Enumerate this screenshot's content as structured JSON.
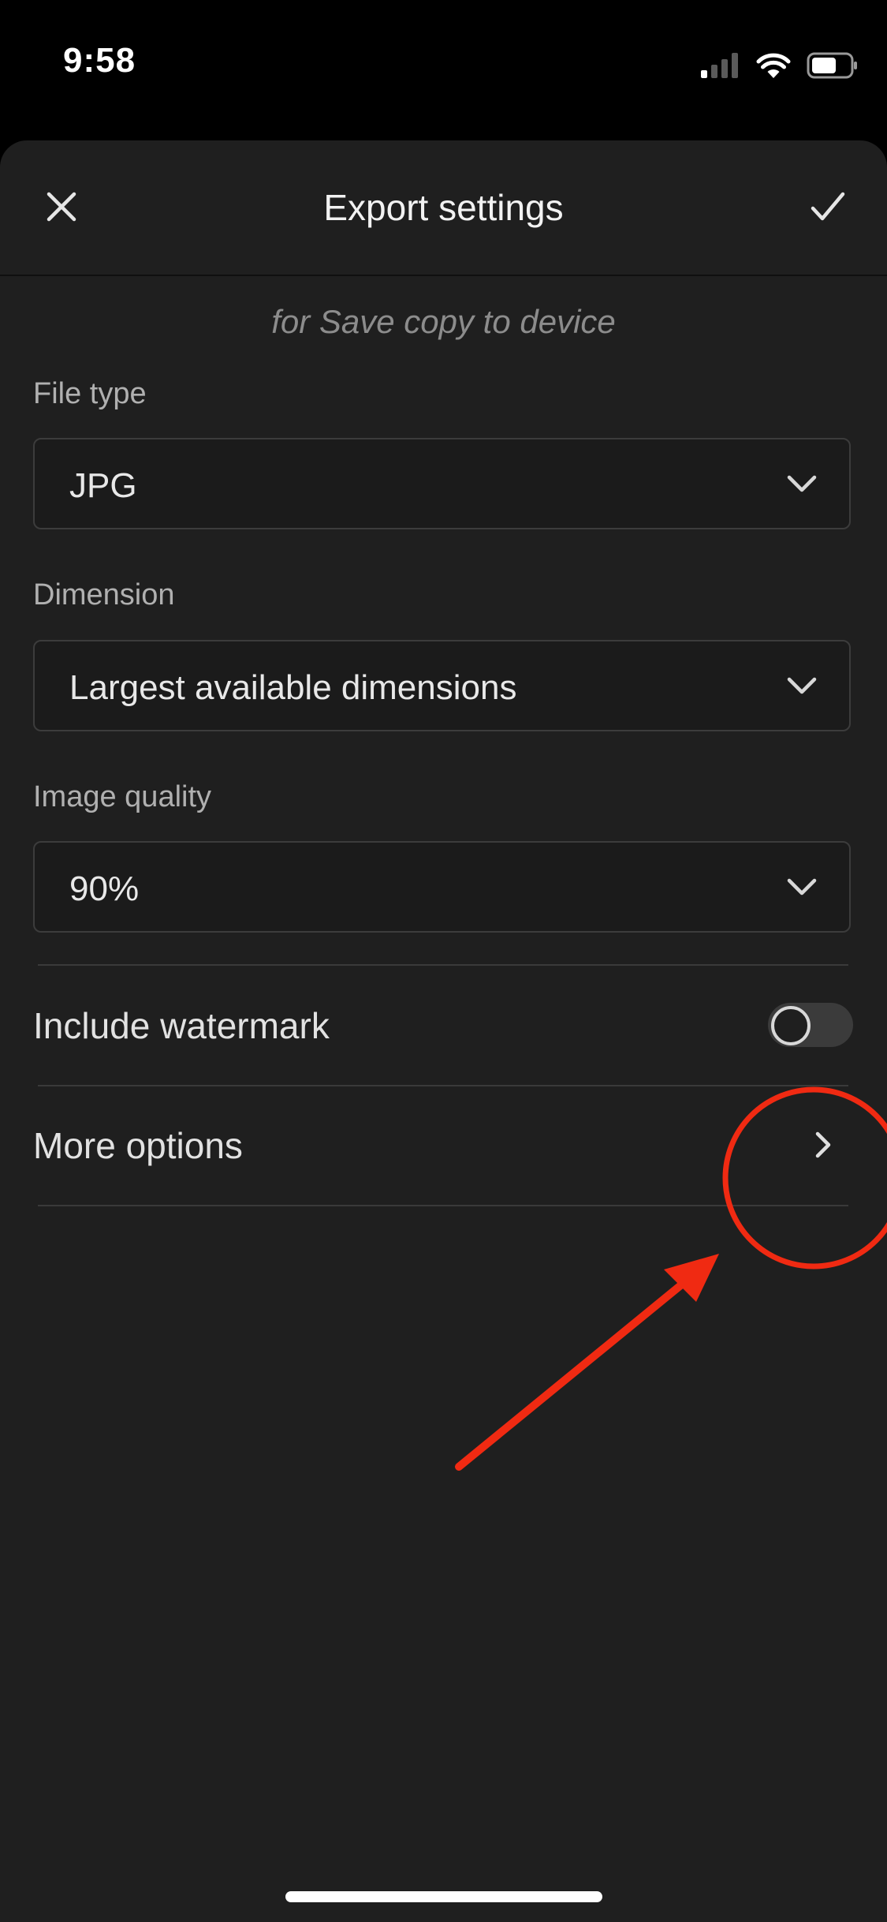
{
  "status_bar": {
    "time": "9:58",
    "icons": [
      "cellular-signal-icon",
      "wifi-icon",
      "battery-icon"
    ]
  },
  "header": {
    "title": "Export settings",
    "close_icon": "close-icon",
    "confirm_icon": "checkmark-icon"
  },
  "subtitle": "for Save copy to device",
  "fields": {
    "file_type": {
      "label": "File type",
      "value": "JPG"
    },
    "dimension": {
      "label": "Dimension",
      "value": "Largest available dimensions"
    },
    "image_quality": {
      "label": "Image quality",
      "value": "90%"
    }
  },
  "watermark": {
    "label": "Include watermark",
    "enabled": false
  },
  "more_options": {
    "label": "More options",
    "icon": "chevron-right-icon"
  },
  "colors": {
    "background": "#000000",
    "sheet": "#1f1f1f",
    "annotation_red": "#f02a12"
  }
}
